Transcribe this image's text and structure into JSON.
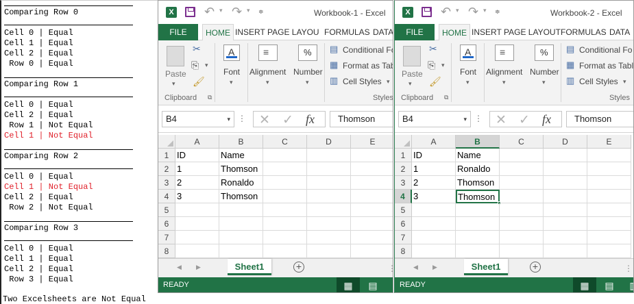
{
  "console": {
    "lines": [
      {
        "text": "Comparing Row 0",
        "color": "#000000"
      },
      {
        "text": "Cell 0 | Equal",
        "color": "#000000"
      },
      {
        "text": "Cell 1 | Equal",
        "color": "#000000"
      },
      {
        "text": "Cell 2 | Equal",
        "color": "#000000"
      },
      {
        "text": " Row 0 | Equal",
        "color": "#000000"
      },
      {
        "text": "Comparing Row 1",
        "color": "#000000"
      },
      {
        "text": "Cell 0 | Equal",
        "color": "#000000"
      },
      {
        "text": "Cell 2 | Equal",
        "color": "#000000"
      },
      {
        "text": " Row 1 | Not Equal",
        "color": "#000000"
      },
      {
        "text": "Cell 1 | Not Equal",
        "color": "#e0202a"
      },
      {
        "text": "Comparing Row 2",
        "color": "#000000"
      },
      {
        "text": "Cell 0 | Equal",
        "color": "#000000"
      },
      {
        "text": "Cell 1 | Not Equal",
        "color": "#e0202a"
      },
      {
        "text": "Cell 2 | Equal",
        "color": "#000000"
      },
      {
        "text": " Row 2 | Not Equal",
        "color": "#000000"
      },
      {
        "text": "Comparing Row 3",
        "color": "#000000"
      },
      {
        "text": "Cell 0 | Equal",
        "color": "#000000"
      },
      {
        "text": "Cell 1 | Equal",
        "color": "#000000"
      },
      {
        "text": "Cell 2 | Equal",
        "color": "#000000"
      },
      {
        "text": " Row 3 | Equal",
        "color": "#000000"
      }
    ],
    "result": "Two Excelsheets are Not Equal"
  },
  "workbooks": [
    {
      "title": "Workbook-1 - Excel",
      "tabs": [
        "FILE",
        "HOME",
        "INSERT",
        "PAGE LAYOU",
        "FORMULAS",
        "DATA"
      ],
      "ribbon": {
        "paste": "Paste",
        "clipboard": "Clipboard",
        "font": "Font",
        "alignment": "Alignment",
        "number": "Number",
        "conditional": "Conditional Fo",
        "format_as_table": "Format as Tab",
        "cell_styles": "Cell Styles",
        "styles": "Styles"
      },
      "name_box": "B4",
      "formula_value": "Thomson",
      "columns": [
        "A",
        "B",
        "C",
        "D",
        "E"
      ],
      "selected_col": "",
      "selected_row": "",
      "rows": [
        [
          "1",
          "ID",
          "Name"
        ],
        [
          "2",
          "1",
          "Thomson"
        ],
        [
          "3",
          "2",
          "Ronaldo"
        ],
        [
          "4",
          "3",
          "Thomson"
        ],
        [
          "5",
          "",
          ""
        ],
        [
          "6",
          "",
          ""
        ],
        [
          "7",
          "",
          ""
        ],
        [
          "8",
          "",
          ""
        ]
      ],
      "sheet_tab": "Sheet1",
      "status": "READY"
    },
    {
      "title": "Workbook-2 - Excel",
      "tabs": [
        "FILE",
        "HOME",
        "INSERT",
        "PAGE LAYOUT",
        "FORMULAS",
        "DATA"
      ],
      "ribbon": {
        "paste": "Paste",
        "clipboard": "Clipboard",
        "font": "Font",
        "alignment": "Alignment",
        "number": "Number",
        "conditional": "Conditional Fo",
        "format_as_table": "Format as Tabl",
        "cell_styles": "Cell Styles",
        "styles": "Styles"
      },
      "name_box": "B4",
      "formula_value": "Thomson",
      "columns": [
        "A",
        "B",
        "C",
        "D",
        "E"
      ],
      "selected_col": "B",
      "selected_row": "4",
      "rows": [
        [
          "1",
          "ID",
          "Name"
        ],
        [
          "2",
          "1",
          "Ronaldo"
        ],
        [
          "3",
          "2",
          "Thomson"
        ],
        [
          "4",
          "3",
          "Thomson"
        ],
        [
          "5",
          "",
          ""
        ],
        [
          "6",
          "",
          ""
        ],
        [
          "7",
          "",
          ""
        ],
        [
          "8",
          "",
          ""
        ]
      ],
      "sheet_tab": "Sheet1",
      "status": "READY"
    }
  ],
  "icons": {
    "excel": "X",
    "undo": "↶",
    "redo": "↷",
    "cut": "scissors-icon",
    "copy": "copy-icon",
    "format_painter": "brush-icon",
    "add_sheet": "+",
    "normal_view": "▦",
    "page_layout_view": "▤",
    "page_break_view": "▥"
  },
  "colors": {
    "excel_green": "#217346",
    "error_red": "#e0202a"
  }
}
